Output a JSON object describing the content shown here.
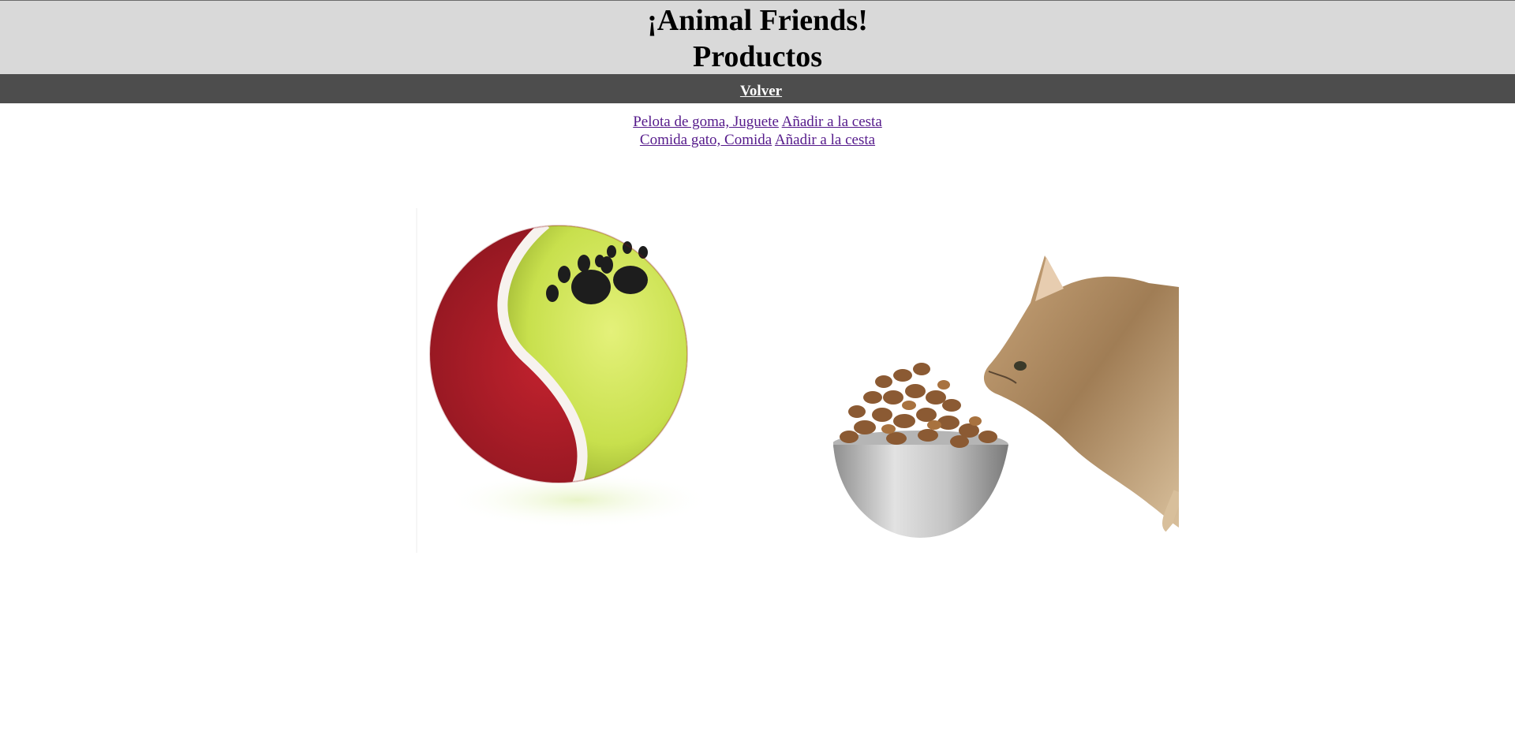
{
  "header": {
    "title": "¡Animal Friends!",
    "subtitle": "Productos"
  },
  "nav": {
    "back_label": "Volver"
  },
  "products": [
    {
      "name": "Pelota de goma, Juguete",
      "add_label": "Añadir a la cesta"
    },
    {
      "name": "Comida gato, Comida",
      "add_label": "Añadir a la cesta"
    }
  ],
  "images": [
    {
      "alt": "tennis-ball-with-paw-prints",
      "icon": "ball-image"
    },
    {
      "alt": "cat-with-food-bowl",
      "icon": "cat-food-image"
    }
  ],
  "colors": {
    "header_bg": "#d9d9d9",
    "nav_bg": "#4d4d4d",
    "visited_link": "#551a8b"
  }
}
